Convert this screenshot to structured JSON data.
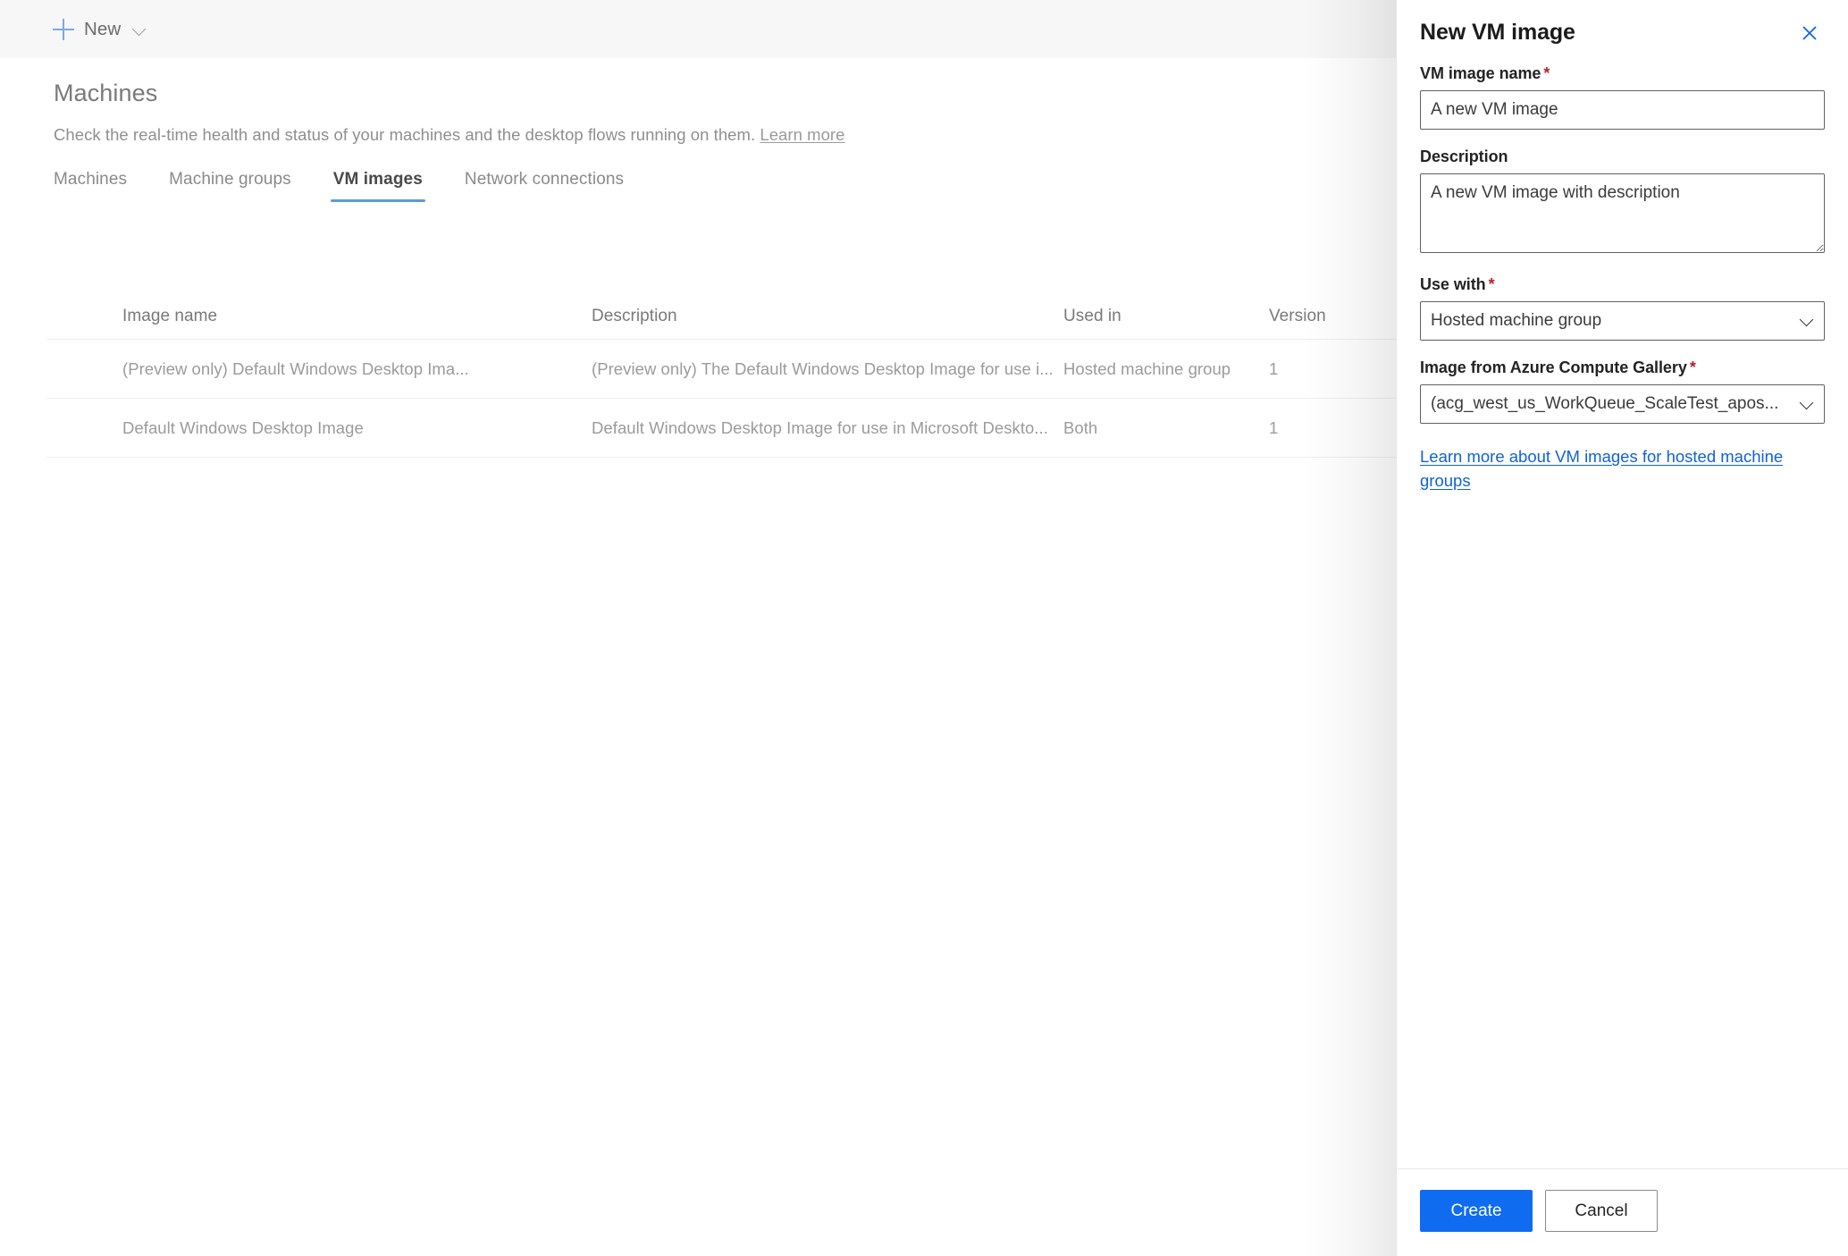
{
  "commandbar": {
    "new_label": "New",
    "plus_icon": "plus-icon",
    "caret_icon": "chevron-down-icon"
  },
  "page": {
    "title": "Machines",
    "subtitle": "Check the real-time health and status of your machines and the desktop flows running on them.",
    "learn_more": "Learn more"
  },
  "tabs": [
    {
      "label": "Machines",
      "active": false
    },
    {
      "label": "Machine groups",
      "active": false
    },
    {
      "label": "VM images",
      "active": true
    },
    {
      "label": "Network connections",
      "active": false
    }
  ],
  "table": {
    "columns": [
      "Image name",
      "Description",
      "Used in",
      "Version"
    ],
    "rows": [
      {
        "name": "(Preview only) Default Windows Desktop Ima...",
        "description": "(Preview only) The Default Windows Desktop Image for use i...",
        "used_in": "Hosted machine group",
        "version": "1"
      },
      {
        "name": "Default Windows Desktop Image",
        "description": "Default Windows Desktop Image for use in Microsoft Deskto...",
        "used_in": "Both",
        "version": "1"
      }
    ]
  },
  "panel": {
    "title": "New VM image",
    "close_icon": "close-icon",
    "fields": {
      "vm_image_name": {
        "label": "VM image name",
        "required": "*",
        "value": "A new VM image"
      },
      "description": {
        "label": "Description",
        "value": "A new VM image with description"
      },
      "use_with": {
        "label": "Use with",
        "required": "*",
        "value": "Hosted machine group",
        "caret_icon": "chevron-down-icon"
      },
      "gallery_image": {
        "label": "Image from Azure Compute Gallery",
        "required": "*",
        "value": "(acg_west_us_WorkQueue_ScaleTest_apos...",
        "caret_icon": "chevron-down-icon"
      }
    },
    "link": "Learn more about VM images for hosted machine groups",
    "buttons": {
      "create": "Create",
      "cancel": "Cancel"
    }
  },
  "colors": {
    "accent_blue": "#0f6cf0",
    "link_blue": "#0f62d6",
    "tab_underline": "#5b9bd5",
    "required_red": "#b4252a",
    "commandbar_bg": "#f7f7f7"
  }
}
